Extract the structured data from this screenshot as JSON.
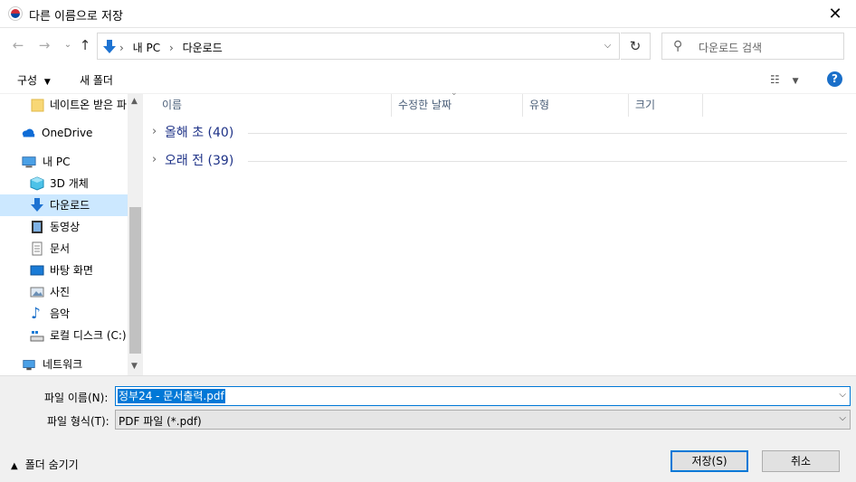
{
  "window": {
    "title": "다른 이름으로 저장"
  },
  "nav": {
    "breadcrumb": [
      "내 PC",
      "다운로드"
    ],
    "search_placeholder": "다운로드 검색"
  },
  "toolbar": {
    "organize": "구성",
    "new_folder": "새 폴더"
  },
  "sidebar": {
    "items": [
      {
        "label": "네이트온 받은 파",
        "icon": "folder-icon"
      },
      {
        "label": "OneDrive",
        "icon": "cloud-icon"
      },
      {
        "label": "내 PC",
        "icon": "computer-icon"
      },
      {
        "label": "3D 개체",
        "icon": "cube-icon"
      },
      {
        "label": "다운로드",
        "icon": "download-icon",
        "selected": true
      },
      {
        "label": "동영상",
        "icon": "video-icon"
      },
      {
        "label": "문서",
        "icon": "document-icon"
      },
      {
        "label": "바탕 화면",
        "icon": "desktop-icon"
      },
      {
        "label": "사진",
        "icon": "picture-icon"
      },
      {
        "label": "음악",
        "icon": "music-icon"
      },
      {
        "label": "로컬 디스크 (C:)",
        "icon": "drive-icon"
      },
      {
        "label": "네트워크",
        "icon": "network-icon"
      }
    ]
  },
  "columns": [
    "이름",
    "수정한 날짜",
    "유형",
    "크기"
  ],
  "groups": [
    {
      "label": "올해 초 (40)"
    },
    {
      "label": "오래 전 (39)"
    }
  ],
  "bottom": {
    "filename_label": "파일 이름(N):",
    "filename_value": "정부24 - 문서출력.pdf",
    "filetype_label": "파일 형식(T):",
    "filetype_value": "PDF 파일 (*.pdf)",
    "hide_folders": "폴더 숨기기",
    "save_button": "저장(S)",
    "cancel_button": "취소"
  },
  "colors": {
    "accent": "#0078d7",
    "selected_bg": "#cce8ff",
    "group_text": "#1e3287"
  }
}
